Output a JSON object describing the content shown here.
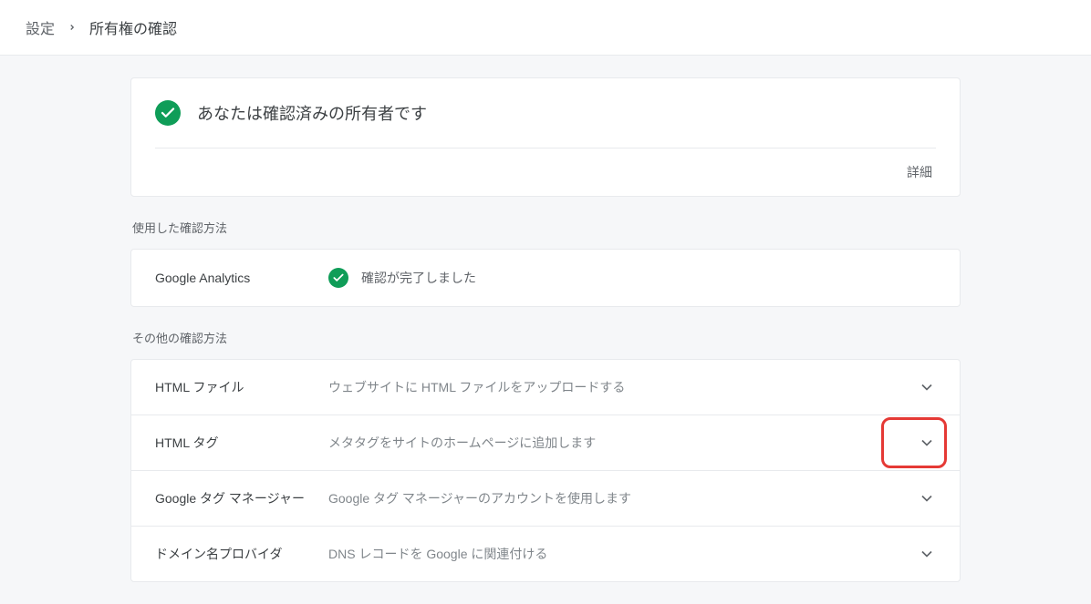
{
  "breadcrumb": {
    "parent": "設定",
    "current": "所有権の確認"
  },
  "verified": {
    "title": "あなたは確認済みの所有者です",
    "details_label": "詳細"
  },
  "used_section": {
    "label": "使用した確認方法",
    "method": {
      "name": "Google Analytics",
      "status": "確認が完了しました"
    }
  },
  "other_section": {
    "label": "その他の確認方法",
    "methods": [
      {
        "name": "HTML ファイル",
        "desc": "ウェブサイトに HTML ファイルをアップロードする"
      },
      {
        "name": "HTML タグ",
        "desc": "メタタグをサイトのホームページに追加します"
      },
      {
        "name": "Google タグ マネージャー",
        "desc": "Google タグ マネージャーのアカウントを使用します"
      },
      {
        "name": "ドメイン名プロバイダ",
        "desc": "DNS レコードを Google に関連付ける"
      }
    ]
  }
}
